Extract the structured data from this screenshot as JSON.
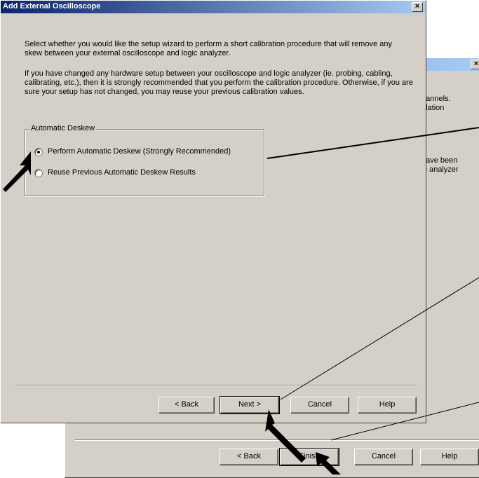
{
  "back_dialog": {
    "close_label": "×",
    "partial_text": {
      "line1": "hannels.",
      "line2": "elation",
      "line3": "have been",
      "line4": "ic analyzer"
    },
    "buttons": {
      "back": "< Back",
      "finish": "Finish",
      "cancel": "Cancel",
      "help": "Help"
    }
  },
  "front_dialog": {
    "title": "Add External Oscilloscope",
    "close_label": "×",
    "intro": "Select whether you would like the setup wizard to perform a short calibration procedure that will remove any skew between your external oscilloscope and logic analyzer.",
    "details": "If you have changed any hardware setup between your oscilloscope and logic analyzer (ie. probing, cabling, calibrating, etc.), then it is strongly recommended that you perform the calibration procedure. Otherwise, if you are sure your setup has not changed, you may reuse your previous calibration values.",
    "group": {
      "label": "Automatic Deskew",
      "options": [
        {
          "label": "Perform Automatic Deskew (Strongly Recommended)",
          "selected": true
        },
        {
          "label": "Reuse Previous Automatic Deskew Results",
          "selected": false
        }
      ]
    },
    "buttons": {
      "back": "< Back",
      "next": "Next >",
      "cancel": "Cancel",
      "help": "Help"
    }
  }
}
